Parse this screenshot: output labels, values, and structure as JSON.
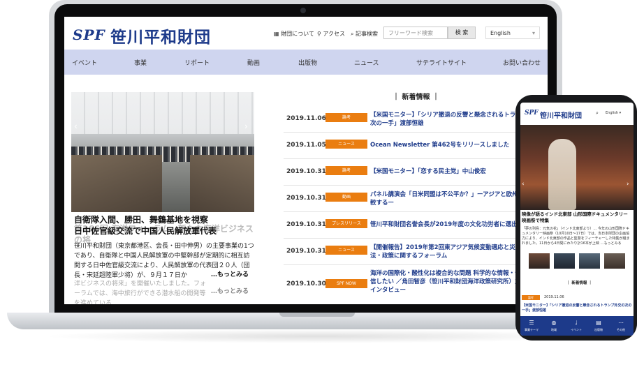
{
  "site": {
    "logo_spf": "SPF",
    "logo_name": "笹川平和財団",
    "util_links": [
      "財団について",
      "アクセス",
      "記事検索"
    ],
    "search_placeholder": "フリーワード検索",
    "search_button": "検 索",
    "language": "English"
  },
  "nav": [
    "イベント",
    "事業",
    "リポート",
    "動画",
    "出版物",
    "ニュース",
    "サテライトサイト",
    "お問い合わせ"
  ],
  "hero": {
    "title": "自衛隊入間、勝田、舞鶴基地を視察",
    "title2": "日中佐官級交流で中国人民解放軍代表",
    "ghost_title": "第166回 海洋フォーラム…新たな海洋ビジネスの将",
    "body": "笹川平和財団（東京都港区、会長・田中伸男）の主要事業の1つであり、自衛隊と中国人民解放軍の中堅幹部が定期的に相互訪問する日中佐官級交流により、人民解放軍の代表団２０人（団長・宋延超陸軍少将）が、９月１７日か",
    "more": "…もっとみる",
    "ghost_body": "洋ビジネスの将来」を開催いたしました。フォーラムでは、海中旅行ができる潜水船の開発等を進めている",
    "more2": "…もっとみる"
  },
  "news": {
    "heading": "新着情報",
    "items": [
      {
        "date": "2019.11.06",
        "badge": "論考",
        "text": "【米国モニター】「シリア撤退の反響と懸念されるトランプ外交の次の一手」渡部恒雄"
      },
      {
        "date": "2019.11.05",
        "badge": "ニュース",
        "text": "Ocean Newsletter 第462号をリリースしました"
      },
      {
        "date": "2019.10.31",
        "badge": "論考",
        "text": "【米国モニター】「恋する民主党」中山俊宏"
      },
      {
        "date": "2019.10.31",
        "badge": "動画",
        "text": "パネル講演会「日米同盟は不公平か？」ーアジアと欧州の同盟を比較するー"
      },
      {
        "date": "2019.10.31",
        "badge": "プレスリリース",
        "text": "笹川平和財団名誉会長が2019年度の文化功労者に選出されました"
      },
      {
        "date": "2019.10.31",
        "badge": "ニュース",
        "text": "【開催報告】2019年第2回東アジア気候変動適応と災害管理の法・政策に関するフォーラム"
      },
      {
        "date": "2019.10.30",
        "badge": "SPF NOW",
        "text": "海洋の国際化・酸性化は複合的な問題 科学的な情報・データを発信したい ／角田智彦（笹川平和財団海洋政策研究所）主任研究員インタビュー"
      }
    ]
  },
  "phone": {
    "logo_spf": "SPF",
    "logo_name": "笹川平和財団",
    "language": "English",
    "hero_title": "映像が語るインド北東部 山形国際ドキュメンタリー映画祭で特集",
    "hero_body": "「夢の列島：元気の花」（インド北東部より）… 今年の山形国際ドキュメンタリー映画祭（10月10日〜17日）では、当日本財団の企画協力により、インド北東部の作品と監督をフィーチャーした特集が組まれました。11日から4日間にわたり計16本が上映 …もっとみる",
    "news_heading": "新着情報",
    "news_badge": "論考",
    "news_date": "2019.11.06",
    "news_text": "【米国モニター】「シリア撤退の反響と懸念されるトランプ外交の次の一手」渡部恒雄",
    "tabs": [
      "事業テーマ",
      "地域",
      "イベント",
      "出版物",
      "その他"
    ]
  }
}
